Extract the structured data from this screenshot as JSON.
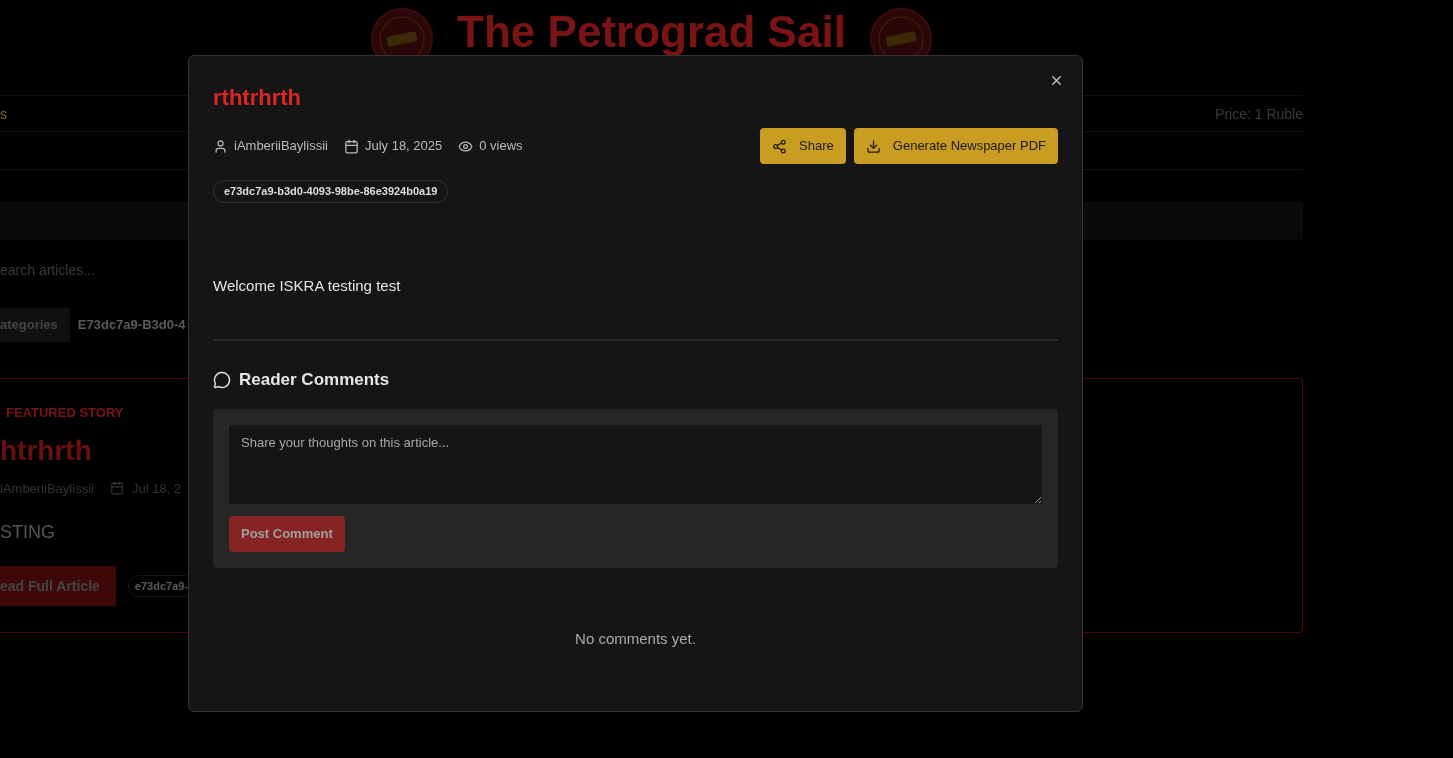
{
  "background_page": {
    "masthead": {
      "title": "The Petrograd Sail"
    },
    "info_bar": {
      "left": "s",
      "price": "Price: 1 Ruble"
    },
    "search": {
      "placeholder": "earch articles..."
    },
    "category_tabs": [
      {
        "label": "ategories",
        "selected": true
      },
      {
        "label": "E73dc7a9-B3d0-4",
        "selected": false
      }
    ],
    "featured": {
      "badge": "FEATURED STORY",
      "title": "htrhrth",
      "author": "iAmberiiBaylissii",
      "date": "Jul 18, 2",
      "excerpt": "STING",
      "button": "ead Full Article",
      "tag": "e73dc7a9-"
    }
  },
  "modal": {
    "title": "rthtrhrth",
    "author": "iAmberiiBaylissii",
    "date": "July 18, 2025",
    "views": "0 views",
    "actions": [
      {
        "label": "Share",
        "kind": "share"
      },
      {
        "label": "Generate Newspaper PDF",
        "kind": "download"
      }
    ],
    "tag": "e73dc7a9-b3d0-4093-98be-86e3924b0a19",
    "body": "Welcome ISKRA testing test",
    "comments": {
      "heading": "Reader Comments",
      "placeholder": "Share your thoughts on this article...",
      "submit": {
        "label": "Post Comment",
        "disabled": true
      },
      "empty": "No comments yet."
    }
  }
}
